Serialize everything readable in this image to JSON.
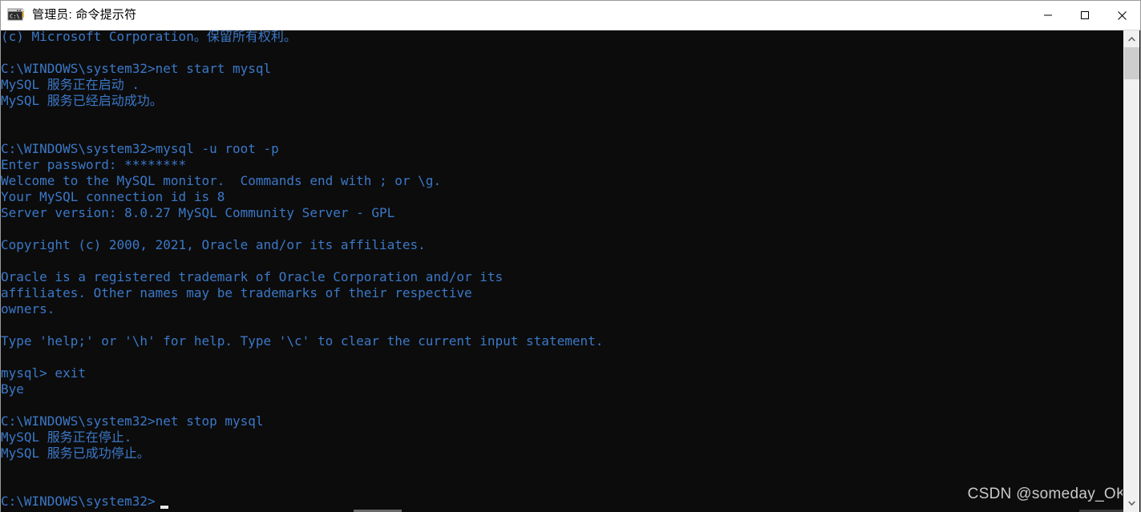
{
  "window": {
    "title": "管理员: 命令提示符",
    "icon": "cmd-icon",
    "controls": {
      "minimize": "最小化",
      "maximize": "最大化",
      "close": "关闭"
    },
    "background_color": "#0c0c0c",
    "text_color": "#3b78c8",
    "titlebar_color": "#ffffff"
  },
  "console": {
    "lines": [
      "(c) Microsoft Corporation。保留所有权利。",
      "",
      "C:\\WINDOWS\\system32>net start mysql",
      "MySQL 服务正在启动 .",
      "MySQL 服务已经启动成功。",
      "",
      "",
      "C:\\WINDOWS\\system32>mysql -u root -p",
      "Enter password: ********",
      "Welcome to the MySQL monitor.  Commands end with ; or \\g.",
      "Your MySQL connection id is 8",
      "Server version: 8.0.27 MySQL Community Server - GPL",
      "",
      "Copyright (c) 2000, 2021, Oracle and/or its affiliates.",
      "",
      "Oracle is a registered trademark of Oracle Corporation and/or its",
      "affiliates. Other names may be trademarks of their respective",
      "owners.",
      "",
      "Type 'help;' or '\\h' for help. Type '\\c' to clear the current input statement.",
      "",
      "mysql> exit",
      "Bye",
      "",
      "C:\\WINDOWS\\system32>net stop mysql",
      "MySQL 服务正在停止.",
      "MySQL 服务已成功停止。",
      "",
      "",
      "C:\\WINDOWS\\system32>"
    ],
    "cursor": "block-cursor"
  },
  "watermark": {
    "text": "CSDN @someday_OK"
  },
  "scrollbar": {
    "vertical": {
      "up_arrow": "▲",
      "down_arrow": "▼",
      "thumb": "scroll-thumb"
    },
    "horizontal": {
      "thumb": "scroll-thumb"
    }
  }
}
